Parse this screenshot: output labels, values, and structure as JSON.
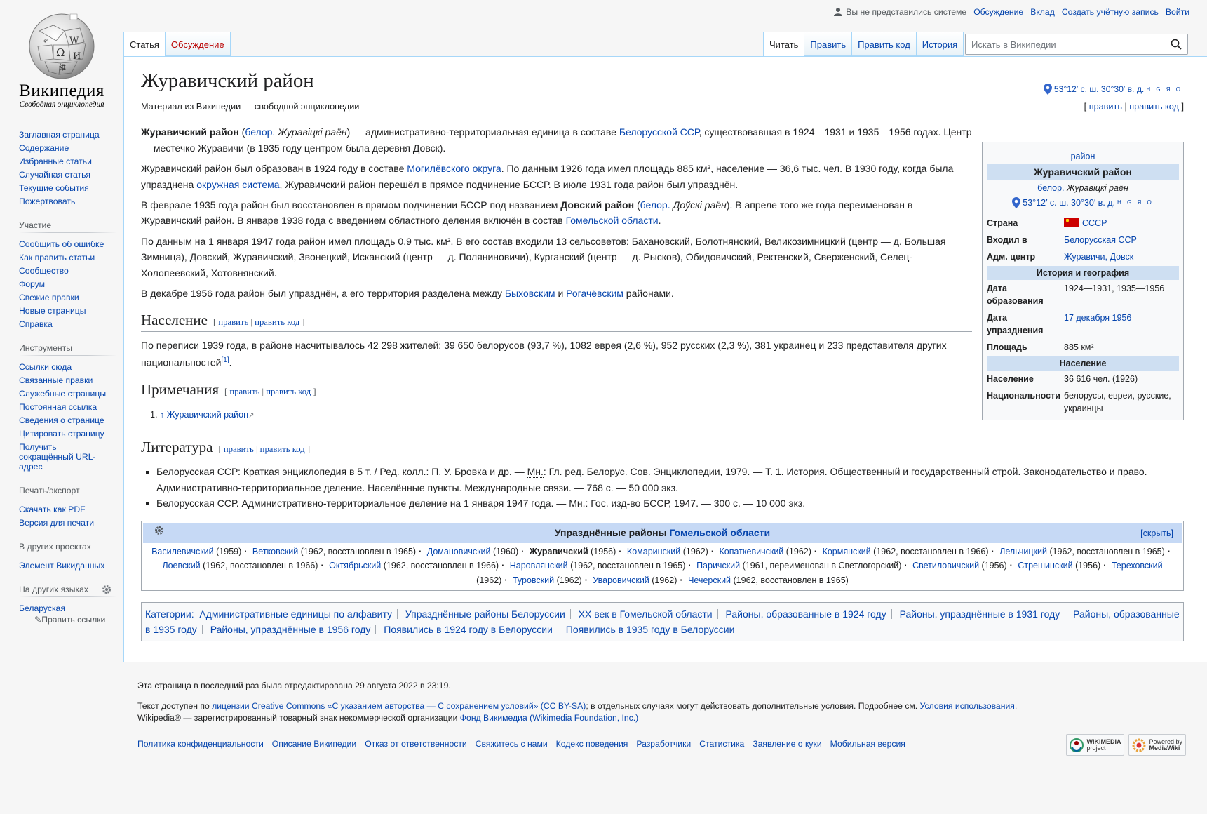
{
  "logo": {
    "wordmark": "Википедия",
    "tagline": "Свободная энциклопедия"
  },
  "personal": {
    "status": "Вы не представились системе",
    "links": [
      "Обсуждение",
      "Вклад",
      "Создать учётную запись",
      "Войти"
    ]
  },
  "tabs": {
    "left": [
      {
        "label": "Статья",
        "selected": true
      },
      {
        "label": "Обсуждение",
        "red": true
      }
    ],
    "right": [
      {
        "label": "Читать",
        "selected": true
      },
      {
        "label": "Править"
      },
      {
        "label": "Править код"
      },
      {
        "label": "История"
      }
    ]
  },
  "search": {
    "placeholder": "Искать в Википедии"
  },
  "sidebar": {
    "nav": [
      "Заглавная страница",
      "Содержание",
      "Избранные статьи",
      "Случайная статья",
      "Текущие события",
      "Пожертвовать"
    ],
    "participation": {
      "title": "Участие",
      "items": [
        "Сообщить об ошибке",
        "Как править статьи",
        "Сообщество",
        "Форум",
        "Свежие правки",
        "Новые страницы",
        "Справка"
      ]
    },
    "tools": {
      "title": "Инструменты",
      "items": [
        "Ссылки сюда",
        "Связанные правки",
        "Служебные страницы",
        "Постоянная ссылка",
        "Сведения о странице",
        "Цитировать страницу",
        "Получить сокращённый URL-адрес"
      ]
    },
    "print": {
      "title": "Печать/экспорт",
      "items": [
        "Скачать как PDF",
        "Версия для печати"
      ]
    },
    "projects": {
      "title": "В других проектах",
      "items": [
        "Элемент Викиданных"
      ]
    },
    "languages": {
      "title": "На других языках",
      "items": [
        "Беларуская"
      ],
      "edit": "Править ссылки"
    }
  },
  "article": {
    "title": "Журавичский район",
    "coords": "53°12′ с. ш. 30°30′ в. д.",
    "coords_sup": "H G Я O",
    "from": "Материал из Википедии — свободной энциклопедии",
    "edit": "править",
    "edit_code": "править код",
    "paragraphs": {
      "p1": {
        "b": "Журавичский район",
        "a": "белор.",
        "i": "Журавіцкі раён",
        "t1": " — административно-территориальная единица в составе ",
        "link1": "Белорусской ССР",
        "t2": ", существовавшая в 1924—1931 и 1935—1956 годах. Центр — местечко Журавичи (в 1935 году центром была деревня Довск)."
      },
      "p2": {
        "t1": "Журавичский район был образован в 1924 году в составе ",
        "link1": "Могилёвского округа",
        "t2": ". По данным 1926 года имел площадь 885 км², население — 36,6 тыс. чел. В 1930 году, когда была упразднена ",
        "link2": "окружная система",
        "t3": ", Журавичский район перешёл в прямое подчинение БССР. В июле 1931 года район был упразднён."
      },
      "p3": {
        "t1": "В феврале 1935 года район был восстановлен в прямом подчинении БССР под названием ",
        "b": "Довский район",
        "a": "белор.",
        "i": "Доўскі раён",
        "t2": ". В апреле того же года переименован в Журавичский район. В январе 1938 года с введением областного деления включён в состав ",
        "link1": "Гомельской области",
        "t3": "."
      },
      "p4": "По данным на 1 января 1947 года район имел площадь 0,9 тыс. км². В его состав входили 13 сельсоветов: Бахановский, Болотнянский, Великозимницкий (центр — д. Большая Зимница), Довский, Журавичский, Звонецкий, Исканский (центр — д. Поляниновичи), Курганский (центр — д. Рысков), Обидовичский, Ректенский, Сверженский, Селец-Холопеевский, Хотовнянский.",
      "p5": {
        "t1": "В декабре 1956 года район был упразднён, а его территория разделена между ",
        "link1": "Быховским",
        "t2": " и ",
        "link2": "Рогачёвским",
        "t3": " районами."
      }
    },
    "sections": {
      "population": {
        "title": "Население",
        "text": "По переписи 1939 года, в районе насчитывалось 42 298 жителей: 39 650 белорусов (93,7 %), 1082 еврея (2,6 %), 952 русских (2,3 %), 381 украинец и 233 представителя других национальностей",
        "ref": "[1]"
      },
      "notes": {
        "title": "Примечания",
        "items": [
          "↑ Журавичский район"
        ]
      },
      "literature": {
        "title": "Литература",
        "items": [
          {
            "t1": "Белорусская ССР: Краткая энциклопедия в 5 т. / Ред. колл.: П. У. Бровка и др. — ",
            "abbr": "Мн.",
            "t2": ": Гл. ред. Белорус. Сов. Энциклопедии, 1979. — Т. 1. История. Общественный и государственный строй. Законодательство и право. Административно-территориальное деление. Населённые пункты. Международные связи. — 768 с. — 50 000 экз."
          },
          {
            "t1": "Белорусская ССР. Административно-территориальное деление на 1 января 1947 года. — ",
            "abbr": "Мн.",
            "t2": ": Гос. изд-во БССР, 1947. — 300 с. — 10 000 экз."
          }
        ]
      }
    }
  },
  "infobox": {
    "above": "район",
    "name": "Журавичский район",
    "native_lang": "белор.",
    "native_name": "Журавіцкі раён",
    "coords": "53°12′ с. ш. 30°30′ в. д.",
    "coords_sup": "H G Я O",
    "rows1": [
      {
        "label": "Страна",
        "value": "СССР",
        "flag": true,
        "link": true
      },
      {
        "label": "Входил в",
        "value": "Белорусская ССР",
        "link": true
      },
      {
        "label": "Адм. центр",
        "value": "Журавичи, Довск",
        "link": true
      }
    ],
    "head1": "История и география",
    "rows2": [
      {
        "label": "Дата образования",
        "value": "1924—1931, 1935—1956"
      },
      {
        "label": "Дата упразднения",
        "value": "17 декабря 1956",
        "link": true
      },
      {
        "label": "Площадь",
        "value": "885 км²"
      }
    ],
    "head2": "Население",
    "rows3": [
      {
        "label": "Население",
        "value": "36 616 чел. (1926)"
      },
      {
        "label": "Национальности",
        "value": "белорусы, евреи, русские, украинцы"
      }
    ]
  },
  "navbox": {
    "title_prefix": "Упразднённые районы ",
    "title_link": "Гомельской области",
    "hide": "[скрыть]",
    "items": [
      {
        "name": "Василевичский",
        "note": " (1959)"
      },
      {
        "name": "Ветковский",
        "note": " (1962, восстановлен в 1965)"
      },
      {
        "name": "Домановичский",
        "note": " (1960)"
      },
      {
        "name": "Журавичский",
        "note": " (1956)",
        "bold": true
      },
      {
        "name": "Комаринский",
        "note": " (1962)"
      },
      {
        "name": "Копаткевичский",
        "note": " (1962)"
      },
      {
        "name": "Кормянский",
        "note": " (1962, восстановлен в 1966)"
      },
      {
        "name": "Лельчицкий",
        "note": " (1962, восстановлен в 1965)"
      },
      {
        "name": "Лоевский",
        "note": " (1962, восстановлен в 1966)"
      },
      {
        "name": "Октябрьский",
        "note": " (1962, восстановлен в 1966)"
      },
      {
        "name": "Наровлянский",
        "note": " (1962, восстановлен в 1965)"
      },
      {
        "name": "Паричский",
        "note": " (1961, переименован в Светлогорский)"
      },
      {
        "name": "Светиловичский",
        "note": " (1956)"
      },
      {
        "name": "Стрешинский",
        "note": " (1956)"
      },
      {
        "name": "Тереховский",
        "note": " (1962)"
      },
      {
        "name": "Туровский",
        "note": " (1962)"
      },
      {
        "name": "Уваровичский",
        "note": " (1962)"
      },
      {
        "name": "Чечерский",
        "note": " (1962, восстановлен в 1965)"
      }
    ]
  },
  "categories": {
    "label": "Категории",
    "items": [
      "Административные единицы по алфавиту",
      "Упразднённые районы Белоруссии",
      "XX век в Гомельской области",
      "Районы, образованные в 1924 году",
      "Районы, упразднённые в 1931 году",
      "Районы, образованные в 1935 году",
      "Районы, упразднённые в 1956 году",
      "Появились в 1924 году в Белоруссии",
      "Появились в 1935 году в Белоруссии"
    ]
  },
  "footer": {
    "lastmod": "Эта страница в последний раз была отредактирована 29 августа 2022 в 23:19.",
    "lic_t1": "Текст доступен по ",
    "lic_link1": "лицензии Creative Commons «С указанием авторства — С сохранением условий» (CC BY-SA)",
    "lic_t2": "; в отдельных случаях могут действовать дополнительные условия. Подробнее см. ",
    "lic_link2": "Условия использования",
    "lic_t3": ".",
    "tm_t1": "Wikipedia® — зарегистрированный товарный знак некоммерческой организации ",
    "tm_link": "Фонд Викимедиа (Wikimedia Foundation, Inc.)",
    "links": [
      "Политика конфиденциальности",
      "Описание Википедии",
      "Отказ от ответственности",
      "Свяжитесь с нами",
      "Кодекс поведения",
      "Разработчики",
      "Статистика",
      "Заявление о куки",
      "Мобильная версия"
    ],
    "badge1": [
      "WIKIMEDIA",
      "project"
    ],
    "badge2": [
      "Powered by",
      "MediaWiki"
    ]
  }
}
